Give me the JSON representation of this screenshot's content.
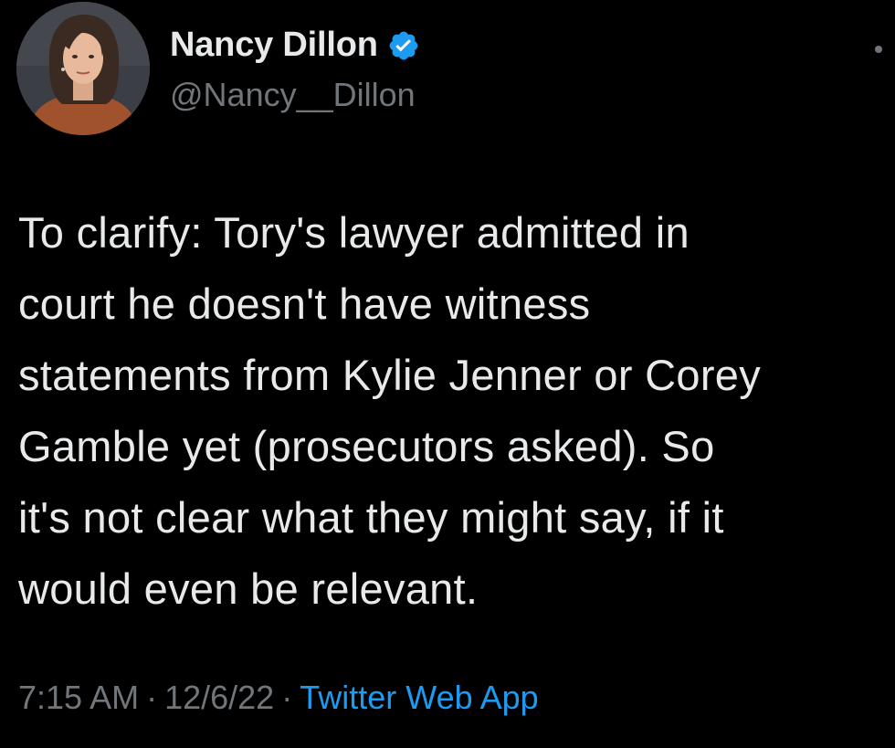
{
  "author": {
    "display_name": "Nancy Dillon",
    "handle": "@Nancy__Dillon",
    "verified": true
  },
  "tweet": {
    "lines": [
      "To clarify: Tory's lawyer admitted in",
      "court he doesn't have witness",
      "statements from Kylie Jenner or Corey",
      "Gamble yet (prosecutors asked). So",
      "it's not clear what they might say, if it",
      "would even be relevant."
    ],
    "time": "7:15 AM",
    "date": "12/6/22",
    "separator": "·",
    "source": "Twitter Web App"
  },
  "colors": {
    "background": "#000000",
    "text": "#e7e9ea",
    "secondary": "#71767b",
    "link": "#1d9bf0",
    "verified_badge": "#1d9bf0"
  },
  "icons": {
    "verified": "verified-badge-icon",
    "more": "more-options-icon"
  }
}
